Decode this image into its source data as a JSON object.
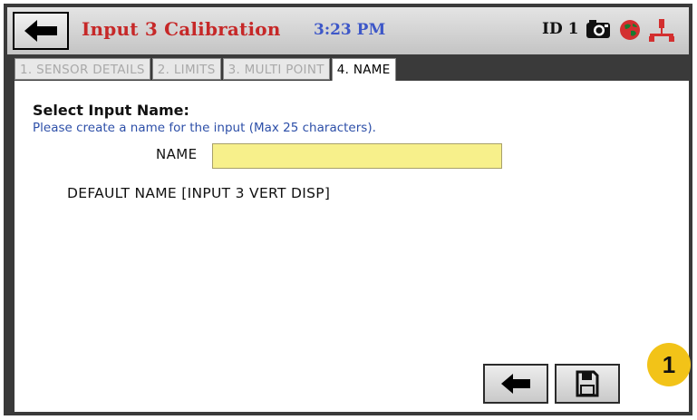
{
  "header": {
    "title": "Input 3 Calibration",
    "time": "3:23 PM",
    "device_id": "ID 1",
    "icons": [
      "back-arrow-icon",
      "camera-icon",
      "globe-icon",
      "network-icon"
    ],
    "title_color": "#c62828",
    "time_color": "#3d57c8"
  },
  "tabs": [
    {
      "label": "1. SENSOR DETAILS",
      "active": false
    },
    {
      "label": "2. LIMITS",
      "active": false
    },
    {
      "label": "3. MULTI POINT",
      "active": false
    },
    {
      "label": "4. NAME",
      "active": true
    }
  ],
  "form": {
    "heading": "Select Input Name:",
    "instructions": "Please create a name for the input (Max 25 characters).",
    "name_label": "NAME",
    "name_value": "",
    "default_name": "DEFAULT NAME [INPUT 3 VERT DISP]",
    "input_color": "#f7f08b"
  },
  "footer": {
    "buttons": [
      "back-arrow-icon",
      "save-icon"
    ],
    "badge": "1",
    "badge_color": "#f2c318"
  }
}
